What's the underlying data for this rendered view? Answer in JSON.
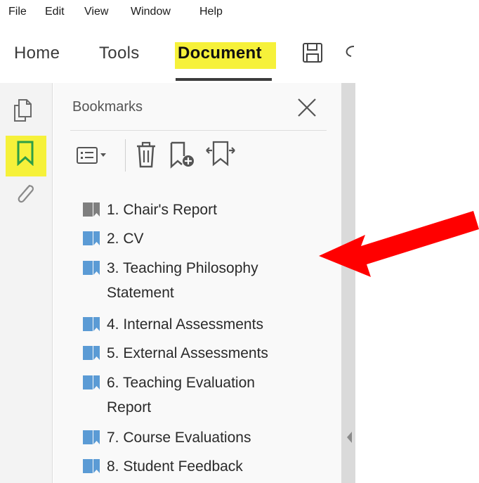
{
  "menu": {
    "items": [
      "File",
      "Edit",
      "View",
      "Window",
      "Help"
    ]
  },
  "tabs": {
    "home": "Home",
    "tools": "Tools",
    "document": "Document"
  },
  "panel": {
    "title": "Bookmarks",
    "bookmarks": [
      {
        "label": "1. Chair's Report",
        "label2": ""
      },
      {
        "label": "2. CV",
        "label2": ""
      },
      {
        "label": "3. Teaching Philosophy",
        "label2": "Statement"
      },
      {
        "label": "4. Internal Assessments",
        "label2": ""
      },
      {
        "label": "5. External Assessments",
        "label2": ""
      },
      {
        "label": "6. Teaching Evaluation",
        "label2": "Report"
      },
      {
        "label": "7. Course Evaluations",
        "label2": ""
      },
      {
        "label": "8. Student Feedback",
        "label2": ""
      }
    ]
  },
  "icons": {
    "rail": [
      "pages-icon",
      "bookmark-icon",
      "attachment-icon"
    ],
    "toolbar": [
      "options-menu-icon",
      "delete-bookmark-icon",
      "new-bookmark-icon",
      "expand-bookmark-icon"
    ],
    "header": [
      "save-icon",
      "close-icon"
    ]
  },
  "colors": {
    "highlight": "#f6f13a",
    "arrow": "#ff0000",
    "bookmark_icon": "#5b9bd5",
    "first_bookmark_icon": "#7f7f7f",
    "scrollbar": "#dadada"
  }
}
